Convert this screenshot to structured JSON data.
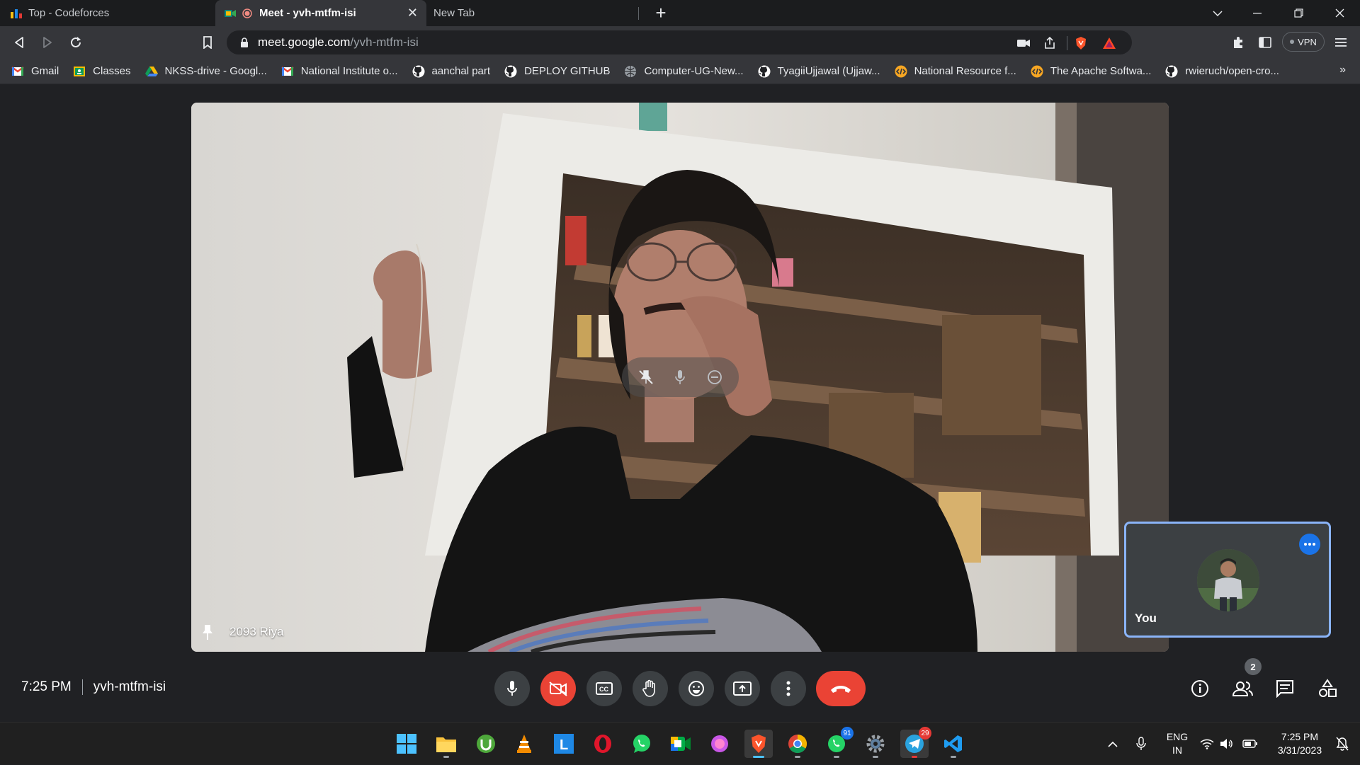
{
  "browser": {
    "tabs": [
      {
        "title": "Top - Codeforces",
        "active": false
      },
      {
        "title": "Meet - yvh-mtfm-isi",
        "active": true
      },
      {
        "title": "New Tab",
        "active": false
      }
    ],
    "url_host": "meet.google.com",
    "url_path": "/yvh-mtfm-isi",
    "vpn_label": "VPN",
    "bookmarks": [
      {
        "label": "Gmail",
        "icon": "gmail-icon"
      },
      {
        "label": "Classes",
        "icon": "classroom-icon"
      },
      {
        "label": "NKSS-drive - Googl...",
        "icon": "drive-icon"
      },
      {
        "label": "National Institute o...",
        "icon": "gmail-icon"
      },
      {
        "label": "aanchal part",
        "icon": "github-icon"
      },
      {
        "label": "DEPLOY GITHUB",
        "icon": "github-icon"
      },
      {
        "label": "Computer-UG-New...",
        "icon": "globe-icon"
      },
      {
        "label": "TyagiiUjjawal (Ujjaw...",
        "icon": "github-icon"
      },
      {
        "label": "National Resource f...",
        "icon": "code-icon"
      },
      {
        "label": "The Apache Softwa...",
        "icon": "code-icon"
      },
      {
        "label": "rwieruch/open-cro...",
        "icon": "github-icon"
      }
    ],
    "more_bookmarks": "»"
  },
  "meet": {
    "time": "7:25 PM",
    "meeting_code": "yvh-mtfm-isi",
    "main_participant": "2093 Riya",
    "self_label": "You",
    "participants_count": "2"
  },
  "taskbar": {
    "whatsapp_badge": "91",
    "telegram_badge": "29",
    "lang_top": "ENG",
    "lang_bottom": "IN",
    "clock_time": "7:25 PM",
    "clock_date": "3/31/2023"
  },
  "colors": {
    "meet_bg": "#202124",
    "end_call": "#ea4335",
    "self_border": "#8ab4f8",
    "accent_blue": "#1a73e8"
  }
}
